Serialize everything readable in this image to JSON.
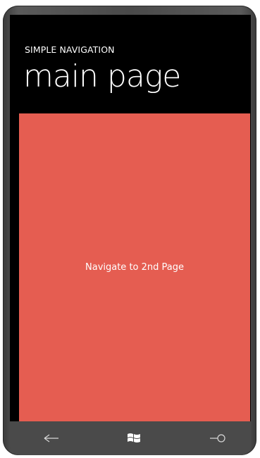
{
  "app": {
    "title": "SIMPLE NAVIGATION",
    "page_title": "main page"
  },
  "main": {
    "navigate_button_label": "Navigate to 2nd Page"
  },
  "hardware_buttons": {
    "back_icon": "back-arrow-icon",
    "start_icon": "windows-logo-icon",
    "search_icon": "search-icon"
  },
  "colors": {
    "screen_background": "#000000",
    "button_background": "#e55d51",
    "text": "#ffffff",
    "chrome": "#4a4a4a"
  }
}
